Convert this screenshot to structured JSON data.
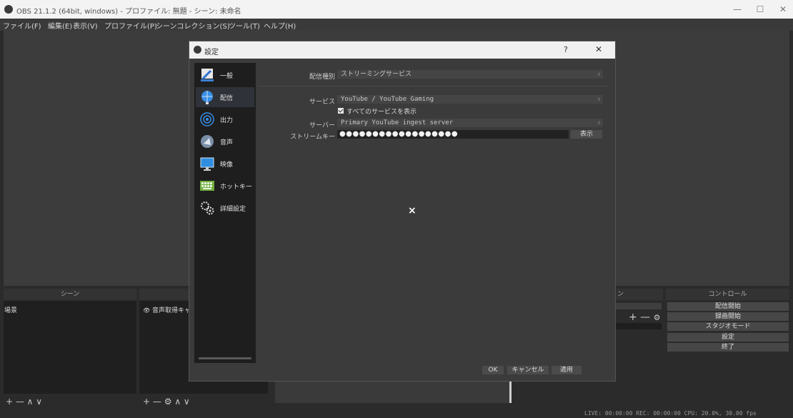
{
  "window": {
    "title": "OBS 21.1.2 (64bit, windows) - プロファイル: 無題 - シーン: 未命名",
    "minimize": "—",
    "maximize": "☐",
    "close": "✕"
  },
  "menu": [
    "ファイル(F)",
    "編集(E)",
    "表示(V)",
    "プロファイル(P)",
    "シーンコレクション(S)",
    "ツール(T)",
    "ヘルプ(H)"
  ],
  "docks": {
    "scenes_header": "シーン",
    "scene_item": "場景",
    "source_item": "音声取得キャプ",
    "mixer_header_fragment": "ン",
    "controls_header": "コントロール",
    "scene_toolbar": "+ — ∧ ∨",
    "source_toolbar_plus": "+",
    "source_toolbar_minus": "—",
    "source_toolbar_updown": "∧ ∨",
    "mixer_plus_minus": "+ —"
  },
  "controls": [
    "配信開始",
    "録画開始",
    "スタジオモード",
    "設定",
    "終了"
  ],
  "statusbar": "LIVE: 00:00:00   REC: 00:00:00   CPU: 20.0%, 30.00 fps",
  "dialog": {
    "title": "設定",
    "help": "?",
    "close": "✕",
    "nav": [
      {
        "label": "一般"
      },
      {
        "label": "配信"
      },
      {
        "label": "出力"
      },
      {
        "label": "音声"
      },
      {
        "label": "映像"
      },
      {
        "label": "ホットキー"
      },
      {
        "label": "詳細設定"
      }
    ],
    "stream_type_label": "配信種別",
    "stream_type_value": "ストリーミングサービス",
    "service_label": "サービス",
    "service_value": "YouTube / YouTube Gaming",
    "show_all_label": "すべてのサービスを表示",
    "server_label": "サーバー",
    "server_value": "Primary YouTube ingest server",
    "key_label": "ストリームキー",
    "key_value": "●●●●●●●●●●●●●●●●●●",
    "show_button": "表示",
    "ok_button": "OK",
    "cancel_button": "キャンセル",
    "apply_button": "適用"
  },
  "overlay_x": "×"
}
